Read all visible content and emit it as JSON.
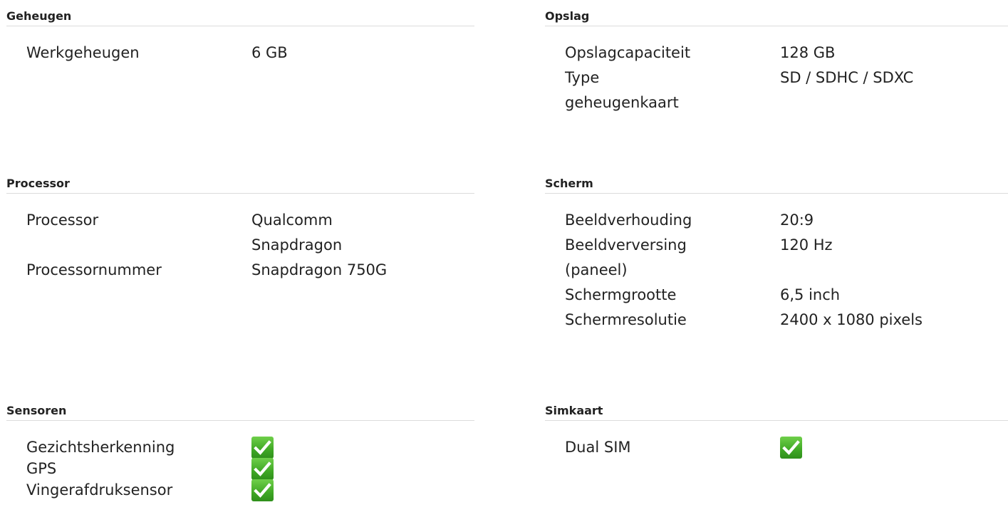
{
  "sections": {
    "geheugen": {
      "title": "Geheugen",
      "rows": [
        {
          "label": "Werkgeheugen",
          "value": "6 GB"
        }
      ]
    },
    "opslag": {
      "title": "Opslag",
      "rows": [
        {
          "label": "Opslagcapaciteit",
          "value": "128 GB"
        },
        {
          "label": "Type geheugenkaart",
          "value": "SD / SDHC / SDXC"
        }
      ]
    },
    "processor": {
      "title": "Processor",
      "rows": [
        {
          "label": "Processor",
          "value": "Qualcomm Snapdragon"
        },
        {
          "label": "Processornummer",
          "value": "Snapdragon 750G"
        }
      ]
    },
    "scherm": {
      "title": "Scherm",
      "rows": [
        {
          "label": "Beeldverhouding",
          "value": "20:9"
        },
        {
          "label": "Beeldverversing (paneel)",
          "value": "120 Hz"
        },
        {
          "label": "Schermgrootte",
          "value": "6,5 inch"
        },
        {
          "label": "Schermresolutie",
          "value": "2400 x 1080 pixels"
        }
      ]
    },
    "sensoren": {
      "title": "Sensoren",
      "rows": [
        {
          "label": "Gezichtsherkenning",
          "value": true,
          "icon": "check-icon"
        },
        {
          "label": "GPS",
          "value": true,
          "icon": "check-icon"
        },
        {
          "label": "Vingerafdruksensor",
          "value": true,
          "icon": "check-icon"
        }
      ]
    },
    "simkaart": {
      "title": "Simkaart",
      "rows": [
        {
          "label": "Dual SIM",
          "value": true,
          "icon": "check-icon"
        }
      ]
    }
  },
  "colors": {
    "check_green": "#3fa825",
    "divider": "#dcdcdc",
    "text": "#222222"
  }
}
